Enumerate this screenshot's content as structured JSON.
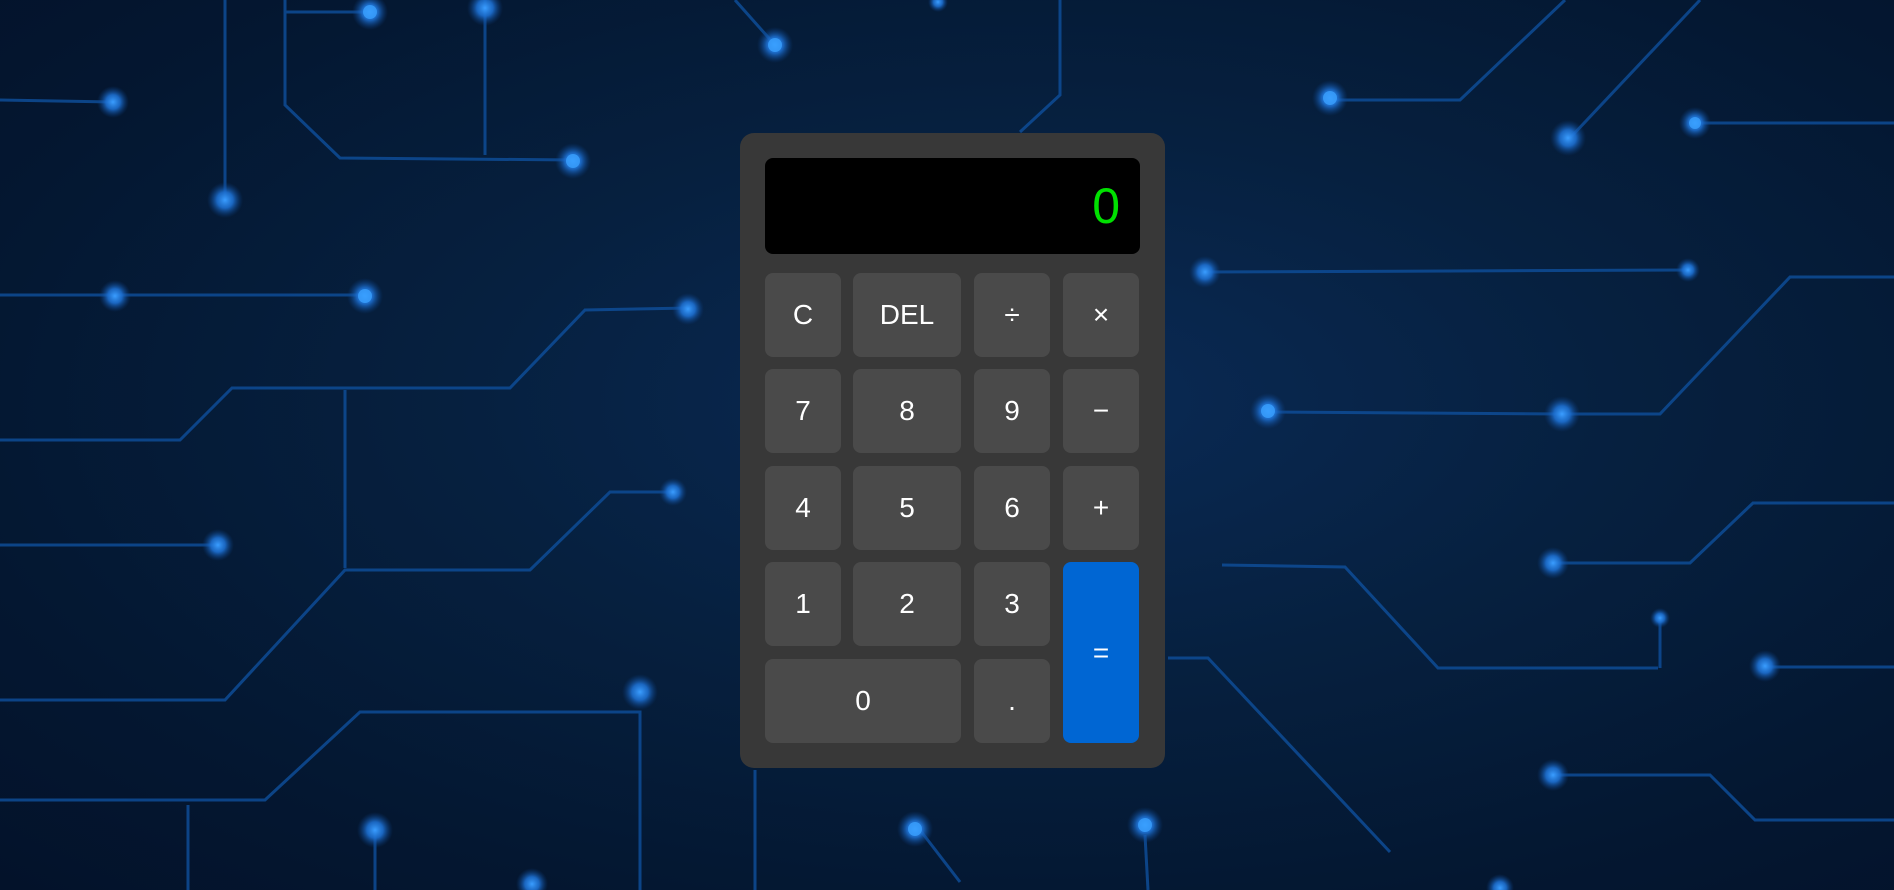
{
  "display": {
    "value": "0"
  },
  "keys": {
    "clear": "C",
    "delete": "DEL",
    "divide": "÷",
    "multiply": "×",
    "seven": "7",
    "eight": "8",
    "nine": "9",
    "subtract": "−",
    "four": "4",
    "five": "5",
    "six": "6",
    "add": "+",
    "one": "1",
    "two": "2",
    "three": "3",
    "equals": "=",
    "zero": "0",
    "decimal": "."
  },
  "colors": {
    "display_text": "#00e000",
    "equals_key": "#0066d3",
    "key": "#4a4a4a",
    "body": "#383838"
  }
}
